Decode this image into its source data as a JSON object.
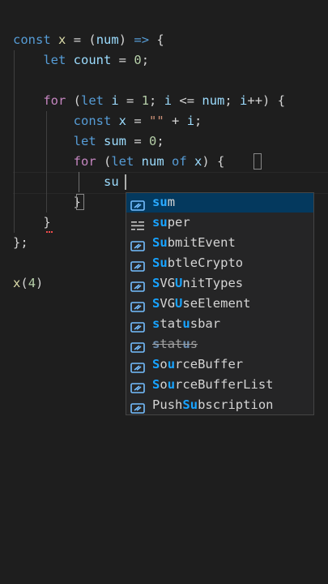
{
  "code_lines": [
    {
      "tokens": [
        {
          "t": "const",
          "c": "kw"
        },
        {
          "t": " ",
          "c": "pun"
        },
        {
          "t": "x",
          "c": "fn"
        },
        {
          "t": " = (",
          "c": "pun"
        },
        {
          "t": "num",
          "c": "var"
        },
        {
          "t": ") ",
          "c": "pun"
        },
        {
          "t": "=>",
          "c": "kw"
        },
        {
          "t": " {",
          "c": "pun"
        }
      ]
    },
    {
      "tokens": [
        {
          "t": "    ",
          "c": "pun"
        },
        {
          "t": "let",
          "c": "kw"
        },
        {
          "t": " ",
          "c": "pun"
        },
        {
          "t": "count",
          "c": "var"
        },
        {
          "t": " = ",
          "c": "pun"
        },
        {
          "t": "0",
          "c": "num"
        },
        {
          "t": ";",
          "c": "pun"
        }
      ]
    },
    {
      "tokens": []
    },
    {
      "tokens": [
        {
          "t": "    ",
          "c": "pun"
        },
        {
          "t": "for",
          "c": "ctl"
        },
        {
          "t": " (",
          "c": "pun"
        },
        {
          "t": "let",
          "c": "kw"
        },
        {
          "t": " ",
          "c": "pun"
        },
        {
          "t": "i",
          "c": "var"
        },
        {
          "t": " = ",
          "c": "pun"
        },
        {
          "t": "1",
          "c": "num"
        },
        {
          "t": "; ",
          "c": "pun"
        },
        {
          "t": "i",
          "c": "var"
        },
        {
          "t": " <= ",
          "c": "pun"
        },
        {
          "t": "num",
          "c": "var"
        },
        {
          "t": "; ",
          "c": "pun"
        },
        {
          "t": "i",
          "c": "var"
        },
        {
          "t": "++) {",
          "c": "pun"
        }
      ]
    },
    {
      "tokens": [
        {
          "t": "        ",
          "c": "pun"
        },
        {
          "t": "const",
          "c": "kw"
        },
        {
          "t": " ",
          "c": "pun"
        },
        {
          "t": "x",
          "c": "var"
        },
        {
          "t": " = ",
          "c": "pun"
        },
        {
          "t": "\"\"",
          "c": "str"
        },
        {
          "t": " + ",
          "c": "pun"
        },
        {
          "t": "i",
          "c": "var"
        },
        {
          "t": ";",
          "c": "pun"
        }
      ]
    },
    {
      "tokens": [
        {
          "t": "        ",
          "c": "pun"
        },
        {
          "t": "let",
          "c": "kw"
        },
        {
          "t": " ",
          "c": "pun"
        },
        {
          "t": "sum",
          "c": "var"
        },
        {
          "t": " = ",
          "c": "pun"
        },
        {
          "t": "0",
          "c": "num"
        },
        {
          "t": ";",
          "c": "pun"
        }
      ]
    },
    {
      "tokens": [
        {
          "t": "        ",
          "c": "pun"
        },
        {
          "t": "for",
          "c": "ctl"
        },
        {
          "t": " (",
          "c": "pun"
        },
        {
          "t": "let",
          "c": "kw"
        },
        {
          "t": " ",
          "c": "pun"
        },
        {
          "t": "num",
          "c": "var"
        },
        {
          "t": " ",
          "c": "pun"
        },
        {
          "t": "of",
          "c": "kw"
        },
        {
          "t": " ",
          "c": "pun"
        },
        {
          "t": "x",
          "c": "var"
        },
        {
          "t": ") {",
          "c": "pun"
        }
      ]
    },
    {
      "tokens": [
        {
          "t": "            ",
          "c": "pun"
        },
        {
          "t": "su",
          "c": "var"
        }
      ]
    },
    {
      "tokens": [
        {
          "t": "        ",
          "c": "pun"
        },
        {
          "t": "}",
          "c": "pun"
        }
      ]
    },
    {
      "tokens": [
        {
          "t": "    ",
          "c": "pun"
        },
        {
          "t": "}",
          "c": "pun"
        }
      ]
    },
    {
      "tokens": [
        {
          "t": "};",
          "c": "pun"
        }
      ]
    },
    {
      "tokens": []
    },
    {
      "tokens": [
        {
          "t": "x",
          "c": "fn"
        },
        {
          "t": "(",
          "c": "pun"
        },
        {
          "t": "4",
          "c": "num"
        },
        {
          "t": ")",
          "c": "pun"
        }
      ]
    }
  ],
  "colors": {
    "background": "#1e1e1e",
    "keyword": "#569cd6",
    "control": "#c586c0",
    "variable": "#9cdcfe",
    "function": "#dcdcaa",
    "number": "#b5cea8",
    "string": "#ce9178",
    "suggest_highlight": "#18a3ff",
    "suggest_selected_bg": "#04395e"
  },
  "suggestions": [
    {
      "label": "sum",
      "match": "su",
      "icon": "variable-icon",
      "selected": true,
      "deprecated": false
    },
    {
      "label": "super",
      "match": "su",
      "icon": "keyword-icon",
      "selected": false,
      "deprecated": false
    },
    {
      "label": "SubmitEvent",
      "match": "Su",
      "icon": "variable-icon",
      "selected": false,
      "deprecated": false
    },
    {
      "label": "SubtleCrypto",
      "match": "Su",
      "icon": "variable-icon",
      "selected": false,
      "deprecated": false
    },
    {
      "label": "SVGUnitTypes",
      "match_chars": [
        0,
        3
      ],
      "icon": "variable-icon",
      "selected": false,
      "deprecated": false
    },
    {
      "label": "SVGUseElement",
      "match_chars": [
        0,
        3
      ],
      "icon": "variable-icon",
      "selected": false,
      "deprecated": false
    },
    {
      "label": "statusbar",
      "match_chars": [
        0,
        4
      ],
      "icon": "variable-icon",
      "selected": false,
      "deprecated": false
    },
    {
      "label": "status",
      "match_chars": [
        0,
        4
      ],
      "icon": "variable-icon",
      "selected": false,
      "deprecated": true
    },
    {
      "label": "SourceBuffer",
      "match_chars": [
        0,
        2
      ],
      "icon": "variable-icon",
      "selected": false,
      "deprecated": false
    },
    {
      "label": "SourceBufferList",
      "match_chars": [
        0,
        2
      ],
      "icon": "variable-icon",
      "selected": false,
      "deprecated": false
    },
    {
      "label": "PushSubscription",
      "match_chars": [
        4,
        5
      ],
      "icon": "variable-icon",
      "selected": false,
      "deprecated": false
    }
  ]
}
